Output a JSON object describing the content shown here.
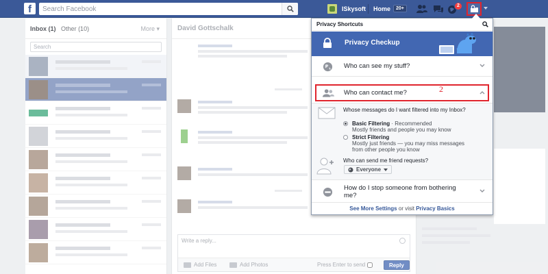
{
  "topbar": {
    "logo": "f",
    "search_placeholder": "Search Facebook",
    "profile_name": "ISkysoft",
    "home_label": "Home",
    "home_count": "20+",
    "notifications_badge": "2"
  },
  "annotations": {
    "step1": "1",
    "step2": "2"
  },
  "colors": {
    "brand": "#3b5998",
    "button_blue": "#4267b2",
    "highlight_red": "#e0242d",
    "badge_red": "#fa3e3e"
  },
  "inbox": {
    "tab_inbox": "Inbox",
    "inbox_count": "(1)",
    "tab_other": "Other",
    "other_count": "(10)",
    "more_label": "More",
    "search_placeholder": "Search"
  },
  "thread": {
    "title": "David Gottschalk",
    "reply_placeholder": "Write a reply...",
    "add_files": "Add Files",
    "add_photos": "Add Photos",
    "press_enter": "Press Enter to send",
    "reply_button": "Reply"
  },
  "privacy_flyout": {
    "header": "Privacy Shortcuts",
    "checkup": "Privacy Checkup",
    "see_stuff": "Who can see my stuff?",
    "contact_me": "Who can contact me?",
    "filter_question": "Whose messages do I want filtered into my Inbox?",
    "basic_title": "Basic Filtering",
    "basic_suffix": " · Recommended",
    "basic_desc": "Mostly friends and people you may know",
    "strict_title": "Strict Filtering",
    "strict_desc": "Mostly just friends — you may miss messages from other people you know",
    "friend_question": "Who can send me friend requests?",
    "friend_value": "Everyone",
    "bother_label": "How do I stop someone from bothering me?",
    "footer_link1": "See More Settings",
    "footer_mid": " or visit ",
    "footer_link2": "Privacy Basics"
  }
}
